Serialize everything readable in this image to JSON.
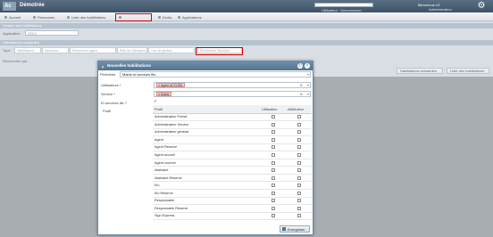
{
  "app": {
    "logo": "Ac",
    "title": "Démotrée"
  },
  "topbar": {
    "user_label": "Bienvenue LE",
    "sublinks": "Utilisateur  ·  Déconnexion",
    "logout": "Administrateur"
  },
  "toolbar": {
    "items": [
      "Accueil",
      "Personnes",
      "Liste des habilitations",
      "",
      "Droits",
      "Applications"
    ]
  },
  "sections": {
    "gestion": "Gestion des habilitations",
    "application_label": "Application",
    "application_value": "GRCI",
    "existantes": "Habilitations existantes"
  },
  "filters": {
    "type_label": "Type",
    "type_value": "Habilitations",
    "attrib_label": "Attribution",
    "agent_label": "Rechercher agent",
    "role_label": "Rôle de l'utilisateur",
    "lieu_label": "Lieu de gestion",
    "structure_label": "Rechercher Structure"
  },
  "search_label": "Rechercher par",
  "right_buttons": [
    "Habilitations existantes",
    "Liste des habilitations"
  ],
  "modal": {
    "title": "Nouvelles habilitations",
    "perimetre_label": "Périmètre",
    "perimetre_value": "Mairie et services fils",
    "utilisateurs_label": "Utilisateurs",
    "utilisateurs_tag": "Agent ACCUEIL",
    "service_label": "Service",
    "service_tag": "Mairie",
    "services_fils_label": "Et services fils ?",
    "profil_label": "Profil",
    "col_profil": "Profil",
    "col_utilisation": "Utilisation",
    "col_attribution": "Attribution",
    "profils": [
      "Administrateur Portail",
      "Administrateur Service",
      "Administrateur général",
      "Agent",
      "Agent Réservé",
      "Agent accueil",
      "Agent courrier",
      "Assistant",
      "Assistant Réservé",
      "Elu",
      "Elu Réservé",
      "Responsable",
      "Responsable Réservé",
      "Sign Express"
    ],
    "save_label": "Enregistrer"
  }
}
